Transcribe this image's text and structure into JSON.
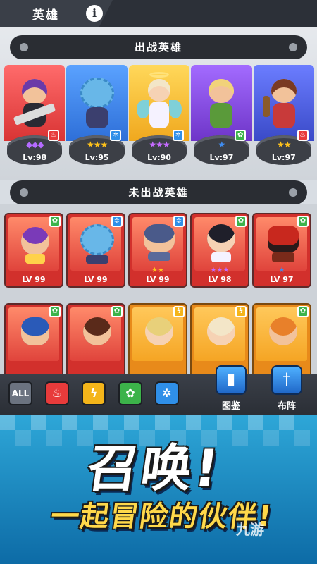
{
  "header": {
    "title": "英雄",
    "info_icon": "i"
  },
  "deployed": {
    "title": "出战英雄",
    "heroes": [
      {
        "level": "Lv:98",
        "stars": "◆◆◆",
        "star_color": "#b46bff",
        "element": "fire",
        "element_glyph": "♨",
        "bg": "#ef4b4b"
      },
      {
        "level": "Lv:95",
        "stars": "★★★",
        "star_color": "#ffc21a",
        "element": "ice",
        "element_glyph": "✲",
        "bg": "#3f8cf0"
      },
      {
        "level": "Lv:90",
        "stars": "★★★",
        "star_color": "#c56bff",
        "element": "ice",
        "element_glyph": "✲",
        "bg": "#f4c42a"
      },
      {
        "level": "Lv:97",
        "stars": "★",
        "star_color": "#3f8cf0",
        "element": "nature",
        "element_glyph": "✿",
        "bg": "#8f4ad8"
      },
      {
        "level": "Lv:97",
        "stars": "★★",
        "star_color": "#ffc21a",
        "element": "fire",
        "element_glyph": "♨",
        "bg": "#4f62d8"
      }
    ]
  },
  "undeployed": {
    "title": "未出战英雄",
    "row1": [
      {
        "level": "LV 99",
        "stars": "",
        "star_color": "#ffc21a",
        "element": "nature",
        "element_glyph": "✿"
      },
      {
        "level": "LV 99",
        "stars": "",
        "star_color": "#ffc21a",
        "element": "ice",
        "element_glyph": "✲"
      },
      {
        "level": "LV 99",
        "stars": "★★",
        "star_color": "#ffc21a",
        "element": "ice",
        "element_glyph": "✲"
      },
      {
        "level": "LV 98",
        "stars": "★★★",
        "star_color": "#c56bff",
        "element": "nature",
        "element_glyph": "✿"
      },
      {
        "level": "LV 97",
        "stars": "★",
        "star_color": "#3f8cf0",
        "element": "nature",
        "element_glyph": "✿"
      }
    ],
    "row2": [
      {
        "element": "nature",
        "element_glyph": "✿"
      },
      {
        "element": "nature",
        "element_glyph": "✿"
      },
      {
        "element": "lightning",
        "element_glyph": "ϟ"
      },
      {
        "element": "lightning",
        "element_glyph": "ϟ"
      },
      {
        "element": "nature",
        "element_glyph": "✿"
      }
    ]
  },
  "filters": {
    "all_label": "ALL",
    "fire": "♨",
    "lightning": "ϟ",
    "nature": "✿",
    "ice": "✲"
  },
  "actions": {
    "codex_label": "图鉴",
    "formation_label": "布阵"
  },
  "promo": {
    "title": "召唤!",
    "subtitle": "一起冒险的伙伴!",
    "watermark": "九游"
  },
  "colors": {
    "fire": "#e83b3b",
    "ice": "#2f8fe8",
    "lightning": "#f4b51a",
    "nature": "#3cb34a",
    "card_red": "#e0443c",
    "card_orange": "#f5a524"
  }
}
